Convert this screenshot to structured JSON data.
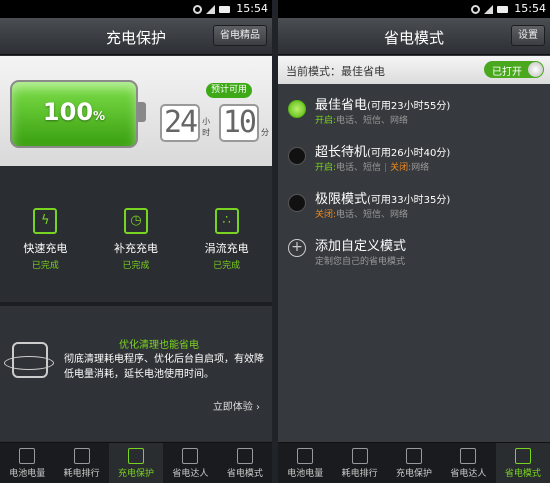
{
  "status_bar": {
    "time": "15:54"
  },
  "left": {
    "title": "充电保护",
    "top_button": "省电精品",
    "battery_percent": "100",
    "battery_percent_unit": "%",
    "estimate_label": "预计可用",
    "hours": "24",
    "hours_unit": "小时",
    "minutes": "10",
    "minutes_unit": "分",
    "charge_modes": [
      {
        "label": "快速充电",
        "status": "已完成",
        "icon": "fast-charge-icon"
      },
      {
        "label": "补充充电",
        "status": "已完成",
        "icon": "supplement-charge-icon"
      },
      {
        "label": "涓流充电",
        "status": "已完成",
        "icon": "trickle-charge-icon"
      }
    ],
    "tip_title": "优化清理也能省电",
    "tip_body": "彻底清理耗电程序、优化后台自启项，有效降低电量消耗，延长电池使用时间。",
    "tip_link": "立即体验"
  },
  "right": {
    "title": "省电模式",
    "top_button": "设置",
    "current_mode_text": "当前模式：最佳省电",
    "toggle_label": "已打开",
    "modes": [
      {
        "name": "最佳省电",
        "duration": "(可用23小时55分)",
        "on": "开启:",
        "on_items": "电话、短信、网络",
        "off": "",
        "off_items": "",
        "selected": true
      },
      {
        "name": "超长待机",
        "duration": "(可用26小时40分)",
        "on": "开启:",
        "on_items": "电话、短信",
        "off": "关闭:",
        "off_items": "网络",
        "selected": false
      },
      {
        "name": "极限模式",
        "duration": "(可用33小时35分)",
        "on": "",
        "on_items": "",
        "off": "关闭:",
        "off_items": "电话、短信、网络",
        "selected": false
      }
    ],
    "add_mode": {
      "label": "添加自定义模式",
      "sub": "定制您自己的省电模式"
    }
  },
  "bottom_nav": [
    {
      "label": "电池电量",
      "icon": "battery-icon"
    },
    {
      "label": "耗电排行",
      "icon": "bar-chart-icon"
    },
    {
      "label": "充电保护",
      "icon": "lightning-icon"
    },
    {
      "label": "省电达人",
      "icon": "leaf-icon"
    },
    {
      "label": "省电模式",
      "icon": "mode-icon"
    }
  ],
  "colors": {
    "accent": "#79d321",
    "warning": "#f08a1f"
  }
}
